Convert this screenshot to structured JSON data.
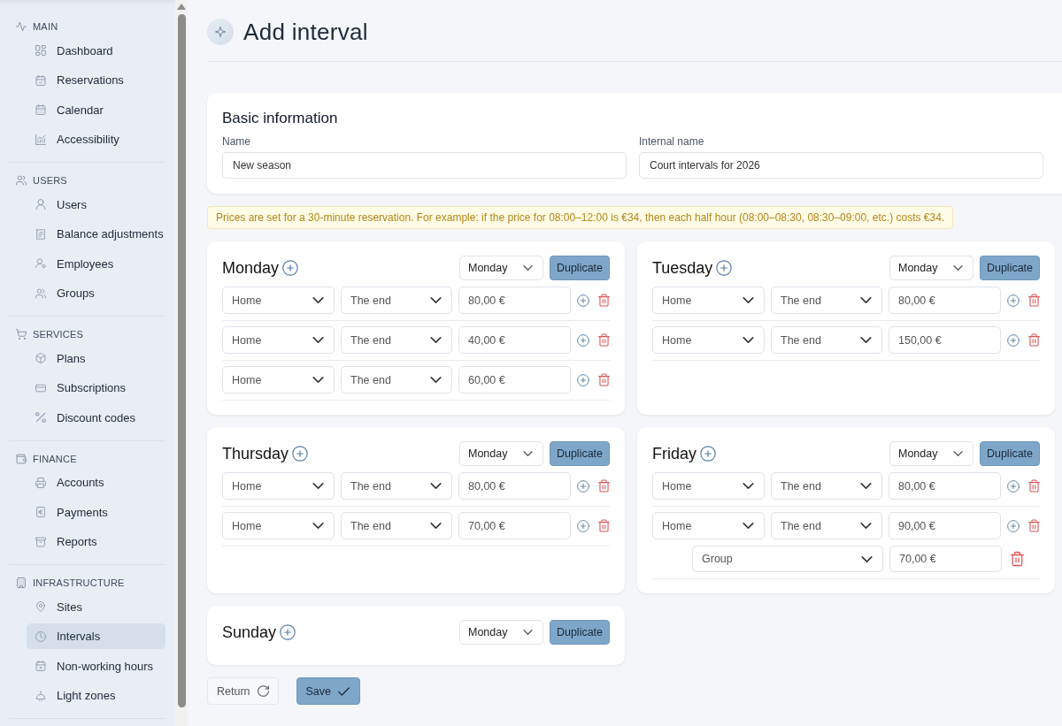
{
  "sidebar": {
    "sections": [
      {
        "title": "MAIN",
        "items": [
          {
            "label": "Dashboard",
            "selected": false
          },
          {
            "label": "Reservations",
            "selected": false
          },
          {
            "label": "Calendar",
            "selected": false
          },
          {
            "label": "Accessibility",
            "selected": false
          }
        ]
      },
      {
        "title": "USERS",
        "items": [
          {
            "label": "Users",
            "selected": false
          },
          {
            "label": "Balance adjustments",
            "selected": false
          },
          {
            "label": "Employees",
            "selected": false
          },
          {
            "label": "Groups",
            "selected": false
          }
        ]
      },
      {
        "title": "SERVICES",
        "items": [
          {
            "label": "Plans",
            "selected": false
          },
          {
            "label": "Subscriptions",
            "selected": false
          },
          {
            "label": "Discount codes",
            "selected": false
          }
        ]
      },
      {
        "title": "FINANCE",
        "items": [
          {
            "label": "Accounts",
            "selected": false
          },
          {
            "label": "Payments",
            "selected": false
          },
          {
            "label": "Reports",
            "selected": false
          }
        ]
      },
      {
        "title": "INFRASTRUCTURE",
        "items": [
          {
            "label": "Sites",
            "selected": false
          },
          {
            "label": "Intervals",
            "selected": true
          },
          {
            "label": "Non-working hours",
            "selected": false
          },
          {
            "label": "Light zones",
            "selected": false
          }
        ]
      }
    ]
  },
  "page": {
    "title": "Add interval"
  },
  "basic_information": {
    "title": "Basic information",
    "fields": [
      {
        "label": "Name",
        "value": "New season"
      },
      {
        "label": "Internal name",
        "value": "Court intervals for 2026"
      }
    ]
  },
  "notice": "Prices are set for a 30-minute reservation. For example: if the price for 08:00–12:00 is €34, then each half hour (08:00–08:30, 08:30–09:00, etc.) costs €34.",
  "days": [
    {
      "name": "Monday",
      "copy_from": "Monday",
      "duplicate_label": "Duplicate",
      "rows": [
        {
          "kind": "interval",
          "start": "Home",
          "end": "The end",
          "price": "80,00 €"
        },
        {
          "kind": "interval",
          "start": "Home",
          "end": "The end",
          "price": "40,00 €"
        },
        {
          "kind": "interval",
          "start": "Home",
          "end": "The end",
          "price": "60,00 €"
        }
      ]
    },
    {
      "name": "Tuesday",
      "copy_from": "Monday",
      "duplicate_label": "Duplicate",
      "rows": [
        {
          "kind": "interval",
          "start": "Home",
          "end": "The end",
          "price": "80,00 €"
        },
        {
          "kind": "interval",
          "start": "Home",
          "end": "The end",
          "price": "150,00 €"
        }
      ]
    },
    {
      "name": "Thursday",
      "copy_from": "Monday",
      "duplicate_label": "Duplicate",
      "rows": [
        {
          "kind": "interval",
          "start": "Home",
          "end": "The end",
          "price": "80,00 €"
        },
        {
          "kind": "interval",
          "start": "Home",
          "end": "The end",
          "price": "70,00 €"
        }
      ]
    },
    {
      "name": "Friday",
      "copy_from": "Monday",
      "duplicate_label": "Duplicate",
      "rows": [
        {
          "kind": "interval",
          "start": "Home",
          "end": "The end",
          "price": "80,00 €"
        },
        {
          "kind": "interval",
          "start": "Home",
          "end": "The end",
          "price": "90,00 €",
          "groups": [
            {
              "group": "Group",
              "price": "70,00 €"
            }
          ]
        }
      ]
    },
    {
      "name": "Sunday",
      "copy_from": "Monday",
      "duplicate_label": "Duplicate"
    }
  ],
  "actions": [
    {
      "label": "Return",
      "kind": "secondary"
    },
    {
      "label": "Save",
      "kind": "primary"
    }
  ]
}
